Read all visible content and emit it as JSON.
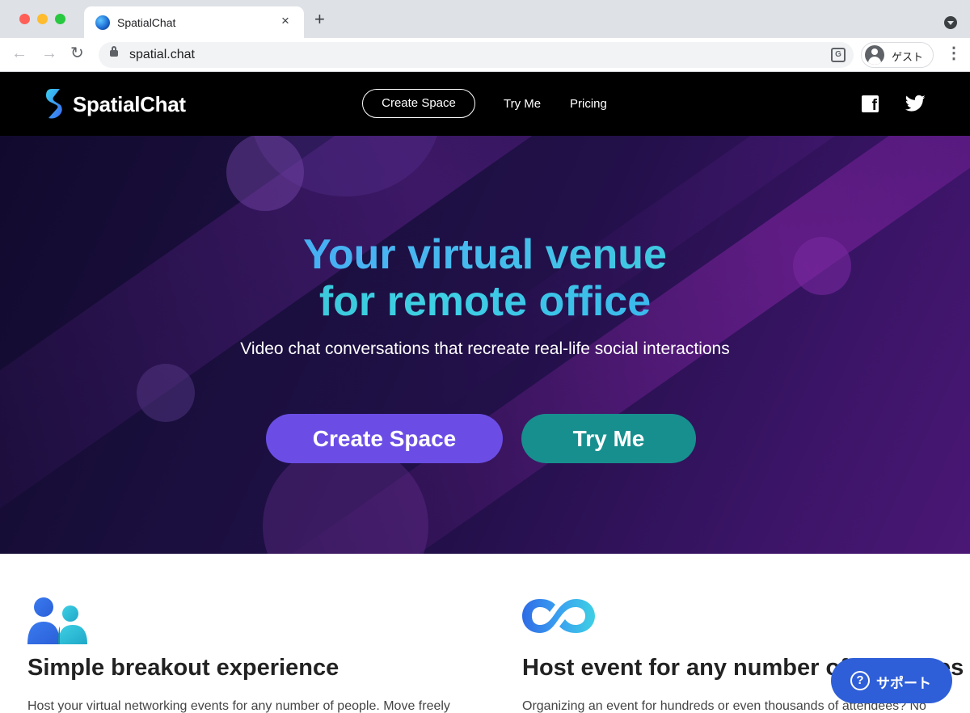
{
  "browser": {
    "tab_title": "SpatialChat",
    "tab_close": "×",
    "new_tab": "+",
    "url": "spatial.chat",
    "profile_label": "ゲスト",
    "translate_glyph": "G",
    "menu": "⋮",
    "back": "←",
    "forward": "→",
    "reload": "↻"
  },
  "header": {
    "logo_text": "SpatialChat",
    "nav": {
      "create_space": "Create Space",
      "try_me": "Try Me",
      "pricing": "Pricing"
    },
    "social": [
      "facebook-icon",
      "twitter-icon"
    ],
    "facebook_glyph": "f"
  },
  "hero": {
    "title_line1": "Your virtual venue",
    "title_line2": "for remote office",
    "subtitle": "Video chat conversations that recreate real-life social interactions",
    "cta_create": "Create Space",
    "cta_try": "Try Me"
  },
  "features": [
    {
      "icon": "people-icon",
      "title": "Simple breakout experience",
      "text": "Host your virtual networking events for any number of people. Move freely"
    },
    {
      "icon": "infinity-icon",
      "title": "Host event for any number of attendees",
      "text": "Organizing an event for hundreds or even thousands of attendees? No"
    }
  ],
  "support": {
    "label": "サポート",
    "icon_glyph": "?"
  },
  "colors": {
    "header_bg": "#000000",
    "create_button": "#6b4de6",
    "try_button": "#178f8e",
    "support_button": "#2f5fd8",
    "title_gradient_start": "#3aa0f0",
    "title_gradient_end": "#3ed0e4"
  }
}
